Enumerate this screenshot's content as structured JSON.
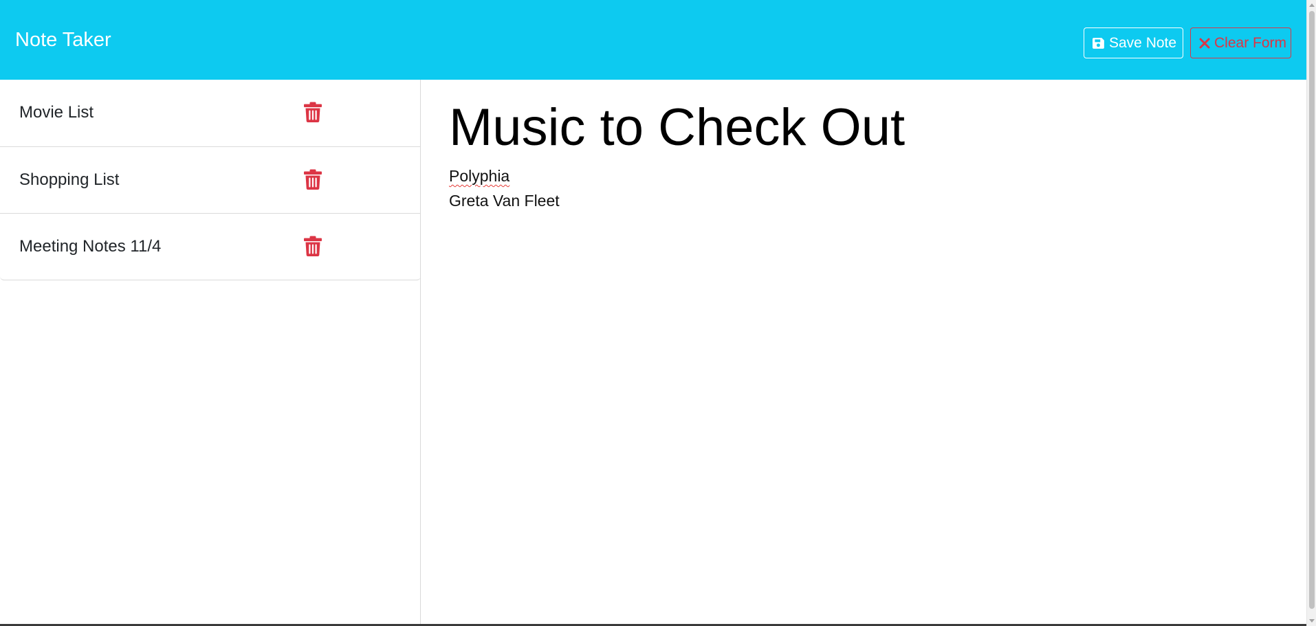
{
  "app": {
    "brand": "Note Taker",
    "accent_color": "#0dcaf0",
    "danger_color": "#dc3545"
  },
  "toolbar": {
    "save_label": "Save Note",
    "save_icon": "floppy-disk-icon",
    "clear_label": "Clear Form",
    "clear_icon": "close-x-icon"
  },
  "sidebar": {
    "notes": [
      {
        "title": "Movie List",
        "delete_icon": "trash-icon"
      },
      {
        "title": "Shopping List",
        "delete_icon": "trash-icon"
      },
      {
        "title": "Meeting Notes 11/4",
        "delete_icon": "trash-icon"
      }
    ]
  },
  "editor": {
    "title": "Music to Check Out",
    "body_lines": [
      "Polyphia",
      "Greta Van Fleet"
    ]
  }
}
